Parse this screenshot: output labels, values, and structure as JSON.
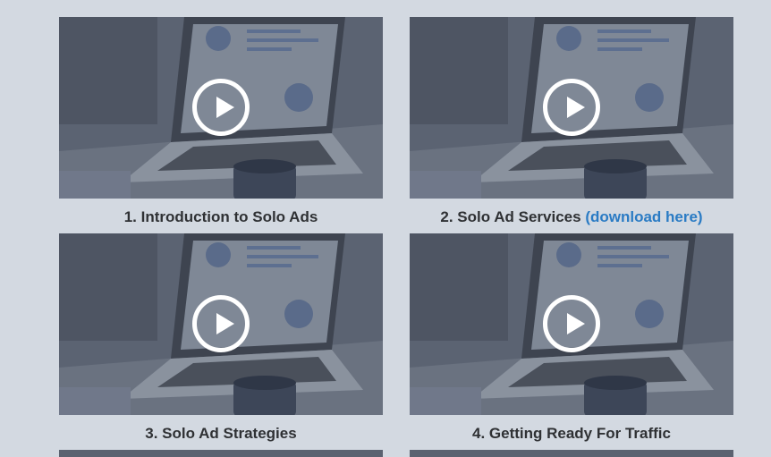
{
  "videos": [
    {
      "title": "1. Introduction to Solo Ads",
      "link": ""
    },
    {
      "title": "2. Solo Ad Services",
      "link": "(download here)"
    },
    {
      "title": "3. Solo Ad Strategies",
      "link": ""
    },
    {
      "title": "4. Getting Ready For Traffic",
      "link": ""
    }
  ],
  "icons": {
    "play": "play-circle-icon"
  },
  "colors": {
    "background": "#d3d9e1",
    "caption": "#2f3134",
    "link": "#2a7bc4",
    "overlay": "#5d6675"
  }
}
